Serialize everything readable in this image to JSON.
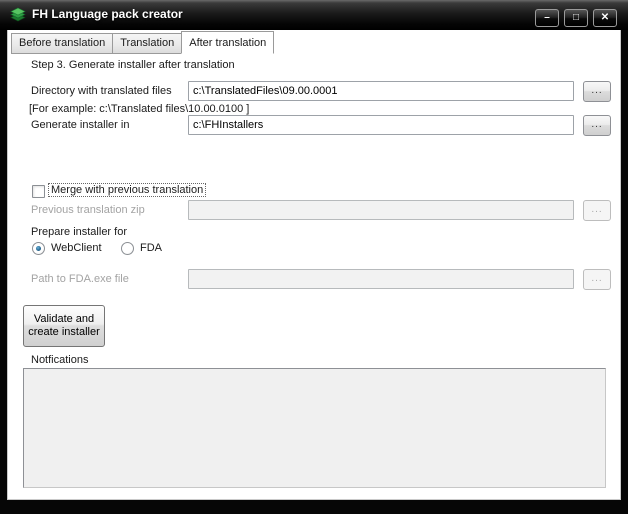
{
  "window": {
    "title": "FH Language pack creator",
    "icon": "layers-icon",
    "controls": {
      "minimize": "–",
      "maximize": "□",
      "close": "✕"
    }
  },
  "tabs": [
    {
      "label": "Before translation",
      "active": false
    },
    {
      "label": "Translation",
      "active": false
    },
    {
      "label": "After translation",
      "active": true
    }
  ],
  "form": {
    "step_title": "Step 3. Generate installer after translation",
    "browse_label": "...",
    "directory": {
      "label": "Directory with translated files",
      "value": "c:\\TranslatedFiles\\09.00.0001"
    },
    "example_hint": "[For example: c:\\Translated files\\10.00.0100 ]",
    "installer": {
      "label": "Generate installer in",
      "value": "c:\\FHInstallers"
    },
    "merge": {
      "label": "Merge with previous translation",
      "checked": false
    },
    "previous_zip": {
      "label": "Previous translation zip",
      "value": "",
      "disabled": true
    },
    "prepare_label": "Prepare installer for",
    "targets": [
      {
        "label": "WebClient",
        "selected": true
      },
      {
        "label": "FDA",
        "selected": false
      }
    ],
    "fda_path": {
      "label": "Path to FDA.exe file",
      "value": "",
      "disabled": true
    },
    "validate_button": "Validate and create installer",
    "notifications": {
      "label": "Notfications",
      "content": ""
    }
  },
  "colors": {
    "accent_green": "#3fae49",
    "titlebar": "#0a0a0a",
    "disabled_text": "#a3a3a3",
    "content_bg": "#ffffff",
    "notif_bg": "#f0f0f0"
  }
}
